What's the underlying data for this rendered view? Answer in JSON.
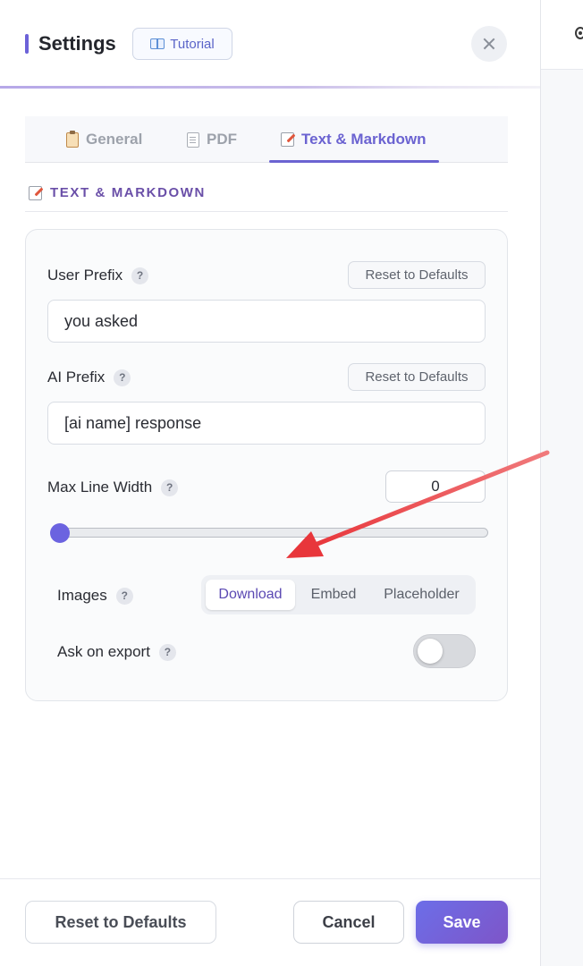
{
  "header": {
    "title": "Settings",
    "tutorial_label": "Tutorial",
    "tutorial_icon": "book-icon",
    "close_icon": "close-icon"
  },
  "tabs": [
    {
      "label": "General",
      "icon": "clipboard-icon",
      "active": false
    },
    {
      "label": "PDF",
      "icon": "document-icon",
      "active": false
    },
    {
      "label": "Text & Markdown",
      "icon": "memo-icon",
      "active": true
    }
  ],
  "section": {
    "title": "TEXT & MARKDOWN",
    "icon": "memo-icon"
  },
  "fields": {
    "user_prefix": {
      "label": "User Prefix",
      "value": "you asked",
      "reset_label": "Reset to Defaults"
    },
    "ai_prefix": {
      "label": "AI Prefix",
      "value": "[ai name] response",
      "reset_label": "Reset to Defaults"
    },
    "max_line_width": {
      "label": "Max Line Width",
      "value": "0",
      "slider_fraction": 0
    },
    "images": {
      "label": "Images",
      "options": [
        "Download",
        "Embed",
        "Placeholder"
      ],
      "selected": "Download"
    },
    "ask_on_export": {
      "label": "Ask on export",
      "enabled": false
    }
  },
  "help_glyph": "?",
  "footer": {
    "reset_label": "Reset to Defaults",
    "cancel_label": "Cancel",
    "save_label": "Save"
  },
  "colors": {
    "accent": "#6b63d1",
    "save_gradient_start": "#6c6ee8",
    "save_gradient_end": "#7e55c8",
    "annotation_arrow": "#ec4d51"
  }
}
